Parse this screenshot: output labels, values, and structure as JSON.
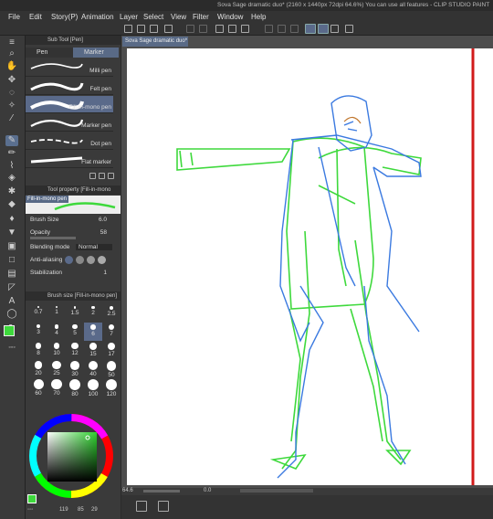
{
  "title": "Sova Sage dramatic duo* (2160 x 1440px 72dpi 64.6%)  You can use all features - CLIP STUDIO PAINT",
  "menu": [
    "File",
    "Edit",
    "Story(P)",
    "Animation",
    "Layer",
    "Select",
    "View",
    "Filter",
    "Window",
    "Help"
  ],
  "subtool": {
    "panel_title": "Sub Tool [Pen]",
    "tabs": [
      "Pen",
      "Marker"
    ],
    "brushes": [
      "Milli pen",
      "Felt pen",
      "Fill-in-mono pen",
      "Marker pen",
      "Dot pen",
      "Flat marker"
    ]
  },
  "tool_property": {
    "panel_title": "Tool property [Fill-in-mono pen]",
    "preview_label": "Fill-in-mono pen",
    "brush_size_label": "Brush Size",
    "brush_size_value": "6.0",
    "opacity_label": "Opacity",
    "opacity_value": "58",
    "blending_label": "Blending mode",
    "blending_value": "Normal",
    "antialias_label": "Anti-aliasing",
    "stabilization_label": "Stabilization",
    "stabilization_value": "1"
  },
  "brush_size": {
    "panel_title": "Brush size [Fill-in-mono pen]",
    "sizes": [
      "0.7",
      "1",
      "1.5",
      "2",
      "2.5",
      "3",
      "4",
      "5",
      "6",
      "7",
      "8",
      "10",
      "12",
      "15",
      "17",
      "20",
      "25",
      "30",
      "40",
      "50",
      "60",
      "70",
      "80",
      "100",
      "120"
    ],
    "selected": "6"
  },
  "color": {
    "accent": "#39d23a",
    "hex_readout": "119",
    "g": "85",
    "b": "29"
  },
  "canvas": {
    "tab_label": "Sova Sage dramatic duo*",
    "zoom": "64.6",
    "nav_value": "0.0"
  },
  "colors": {
    "stroke_green": "#3ed93c",
    "stroke_blue": "#3b7ae0",
    "stroke_red": "#d11a1a",
    "selection": "#5a6a8a"
  }
}
